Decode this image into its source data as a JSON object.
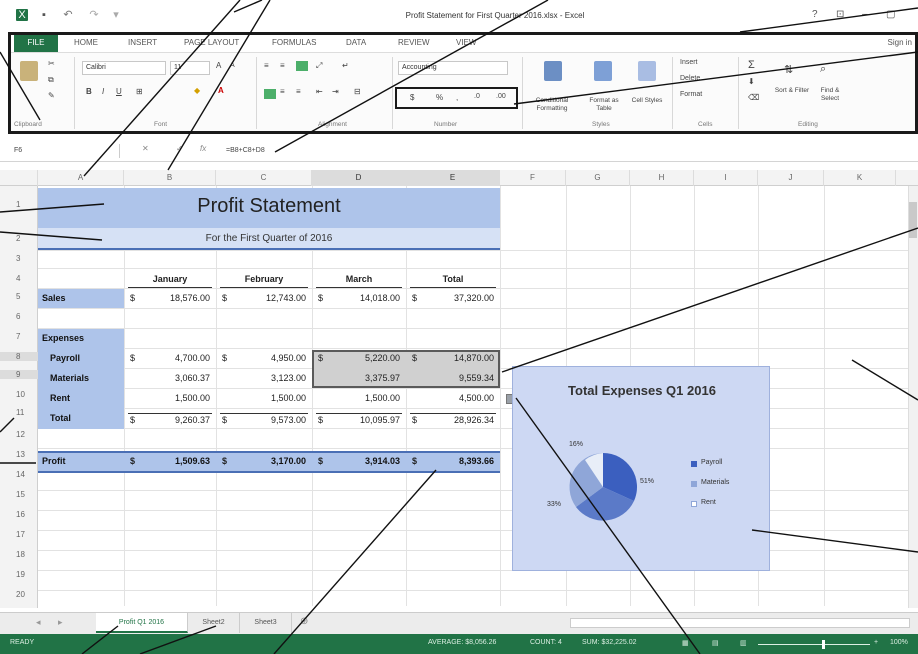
{
  "window": {
    "title": "Profit Statement for First Quarter 2016.xlsx - Excel"
  },
  "ribbon": {
    "tabs": [
      "FILE",
      "HOME",
      "INSERT",
      "PAGE LAYOUT",
      "FORMULAS",
      "DATA",
      "REVIEW",
      "VIEW"
    ],
    "sign_in": "Sign in",
    "font_name": "Calibri",
    "font_size": "11",
    "number_format": "Accounting",
    "groups": [
      "Clipboard",
      "Font",
      "Alignment",
      "Number",
      "Styles",
      "Cells",
      "Editing"
    ],
    "labels": {
      "conditional_formatting": "Conditional Formatting",
      "format_as_table": "Format as Table",
      "cell_styles": "Cell Styles",
      "insert": "Insert",
      "delete": "Delete",
      "format": "Format",
      "sort_filter": "Sort & Filter",
      "find_select": "Find & Select"
    }
  },
  "formula_bar": {
    "name_box": "F6",
    "formula": "=B8+C8+D8"
  },
  "columns": [
    "A",
    "B",
    "C",
    "D",
    "E",
    "F",
    "G",
    "H",
    "I",
    "J",
    "K"
  ],
  "rows": [
    "1",
    "2",
    "3",
    "4",
    "5",
    "6",
    "7",
    "8",
    "9",
    "10",
    "11",
    "12",
    "13",
    "14",
    "15",
    "16",
    "17",
    "18",
    "19",
    "20"
  ],
  "sheet": {
    "title": "Profit Statement",
    "subtitle": "For the First Quarter of 2016",
    "months": [
      "January",
      "February",
      "March",
      "Total"
    ],
    "sales": {
      "label": "Sales",
      "values": [
        "18,576.00",
        "12,743.00",
        "14,018.00",
        "37,320.00"
      ]
    },
    "expenses_label": "Expenses",
    "expense_rows": [
      {
        "label": "Payroll",
        "values": [
          "4,700.00",
          "4,950.00",
          "5,220.00",
          "14,870.00"
        ]
      },
      {
        "label": "Materials",
        "values": [
          "3,060.37",
          "3,123.00",
          "3,375.97",
          "9,559.34"
        ]
      },
      {
        "label": "Rent",
        "values": [
          "1,500.00",
          "1,500.00",
          "1,500.00",
          "4,500.00"
        ]
      },
      {
        "label": "Total",
        "values": [
          "9,260.37",
          "9,573.00",
          "10,095.97",
          "28,926.34"
        ]
      }
    ],
    "profit": {
      "label": "Profit",
      "values": [
        "1,509.63",
        "3,170.00",
        "3,914.03",
        "8,393.66"
      ]
    },
    "currency_symbol": "$"
  },
  "chart": {
    "title": "Total Expenses Q1 2016",
    "legend": [
      "Payroll",
      "Materials",
      "Rent"
    ],
    "slice_labels": [
      "16%",
      "51%",
      "33%"
    ],
    "colors": [
      "#3b5fbf",
      "#8fa6d8",
      "#e8eef8"
    ]
  },
  "sheet_tabs": [
    "Profit Q1 2016",
    "Sheet2",
    "Sheet3"
  ],
  "status": {
    "ready": "READY",
    "average": "AVERAGE: $8,056.26",
    "count": "COUNT: 4",
    "sum": "SUM: $32,225.02",
    "zoom": "100%"
  }
}
